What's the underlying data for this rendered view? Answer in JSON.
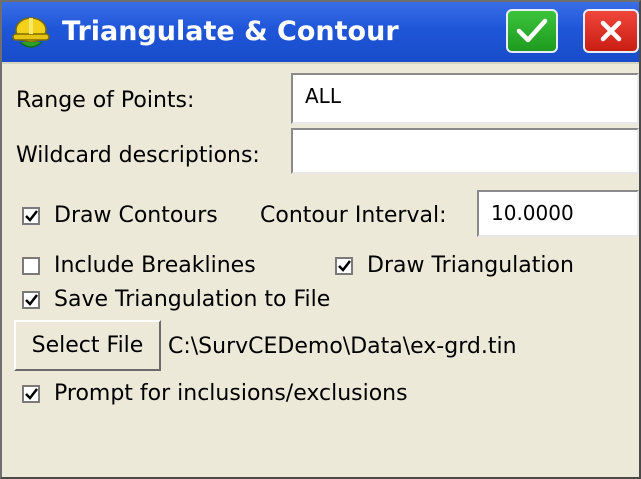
{
  "window": {
    "title": "Triangulate & Contour",
    "icons": {
      "app": "hardhat-icon",
      "ok": "checkmark-icon",
      "close": "close-icon"
    },
    "colors": {
      "titlebar": "#1f56d8",
      "ok": "#2fb52f",
      "close": "#e0281e",
      "background": "#ece9d8"
    }
  },
  "form": {
    "range_label": "Range of Points:",
    "range_value": "ALL",
    "wildcard_label": "Wildcard descriptions:",
    "wildcard_value": "",
    "draw_contours": {
      "label": "Draw Contours",
      "checked": true
    },
    "interval_label": "Contour Interval:",
    "interval_value": "10.0000",
    "include_breaklines": {
      "label": "Include Breaklines",
      "checked": false
    },
    "draw_triangulation": {
      "label": "Draw Triangulation",
      "checked": true
    },
    "save_triangulation": {
      "label": "Save Triangulation to File",
      "checked": true
    },
    "select_file_label": "Select File",
    "file_path": "C:\\SurvCEDemo\\Data\\ex-grd.tin",
    "prompt_inclusions": {
      "label": "Prompt for inclusions/exclusions",
      "checked": true
    }
  }
}
